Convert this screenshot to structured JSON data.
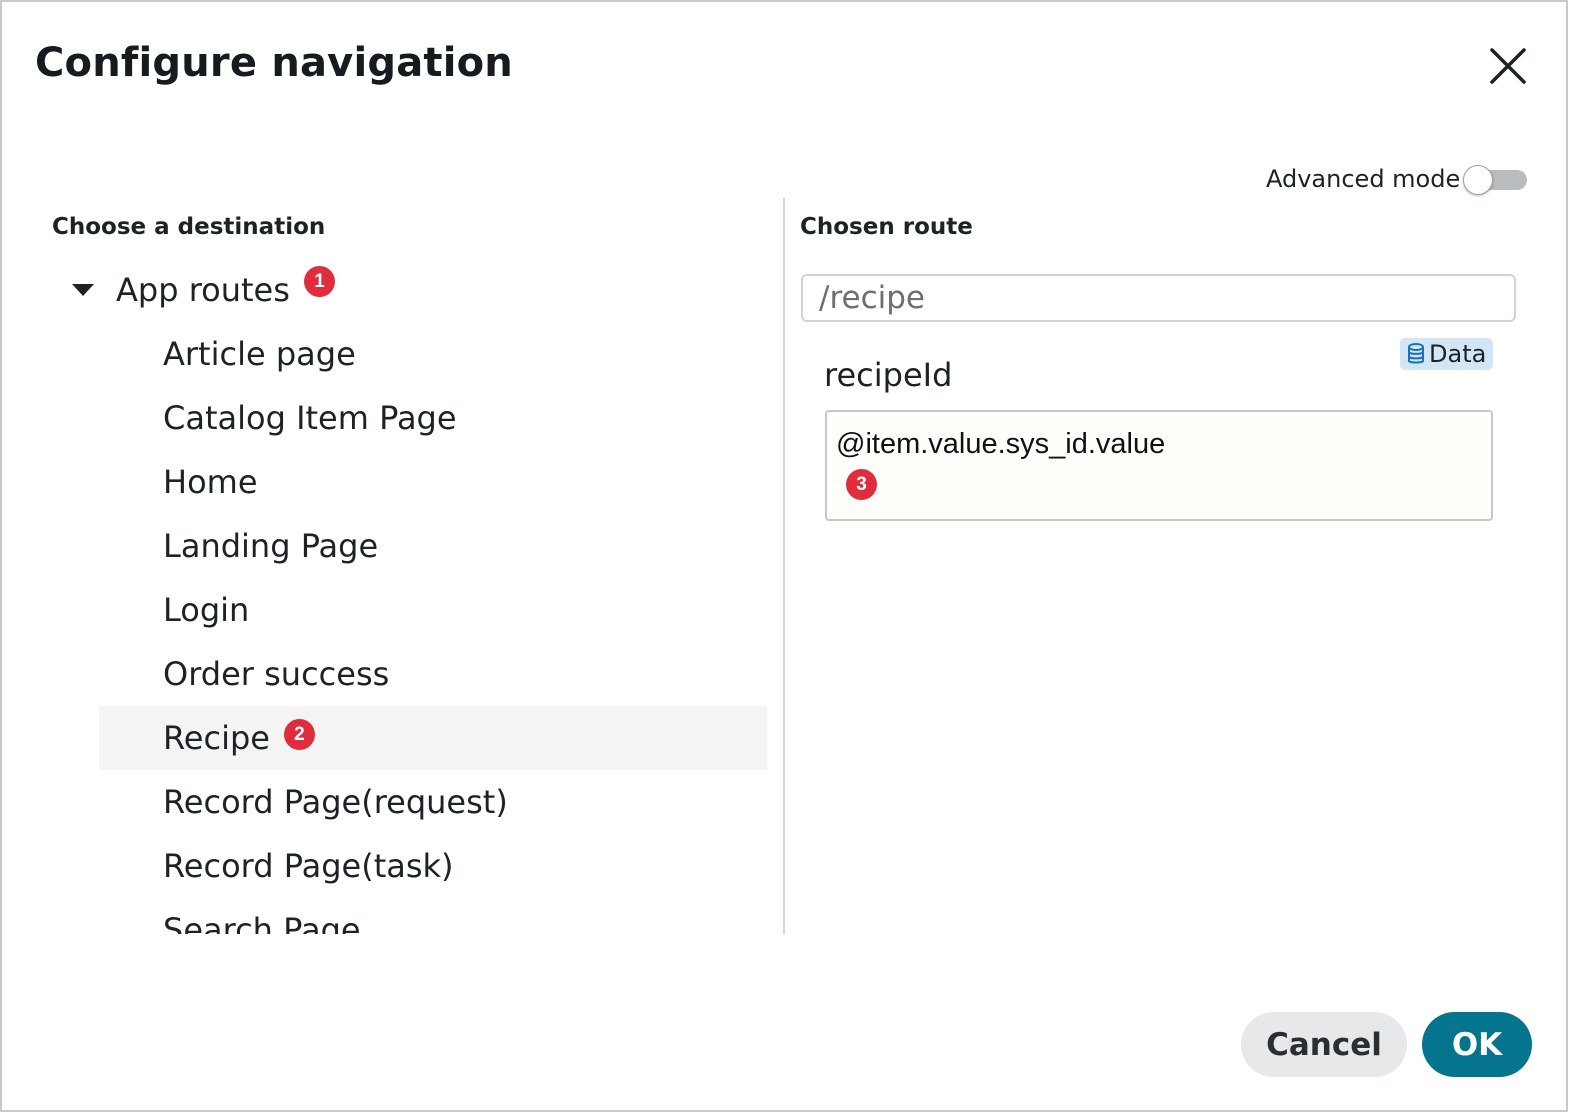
{
  "dialog": {
    "title": "Configure navigation",
    "close_icon": "close-icon"
  },
  "advanced_mode": {
    "label": "Advanced mode",
    "enabled": false
  },
  "destination": {
    "heading": "Choose a destination",
    "root": {
      "label": "App routes",
      "expanded": true,
      "badge": "1",
      "caret_icon": "caret-down-icon"
    },
    "items": [
      {
        "label": "Article page"
      },
      {
        "label": "Catalog Item Page"
      },
      {
        "label": "Home"
      },
      {
        "label": "Landing Page"
      },
      {
        "label": "Login"
      },
      {
        "label": "Order success"
      },
      {
        "label": "Recipe",
        "selected": true,
        "badge": "2"
      },
      {
        "label": "Record Page(request)"
      },
      {
        "label": "Record Page(task)"
      },
      {
        "label": "Search Page"
      }
    ]
  },
  "route": {
    "heading": "Chosen route",
    "value": "/recipe",
    "data_pill": {
      "label": "Data",
      "icon": "database-icon"
    },
    "param": {
      "label": "recipeId",
      "value": "@item.value.sys_id.value",
      "badge": "3"
    }
  },
  "footer": {
    "cancel_label": "Cancel",
    "ok_label": "OK"
  },
  "colors": {
    "primary": "#04758c",
    "badge": "#e02d3d",
    "data_pill": "#d2e6f5",
    "selected_row": "#f4f4f4"
  }
}
